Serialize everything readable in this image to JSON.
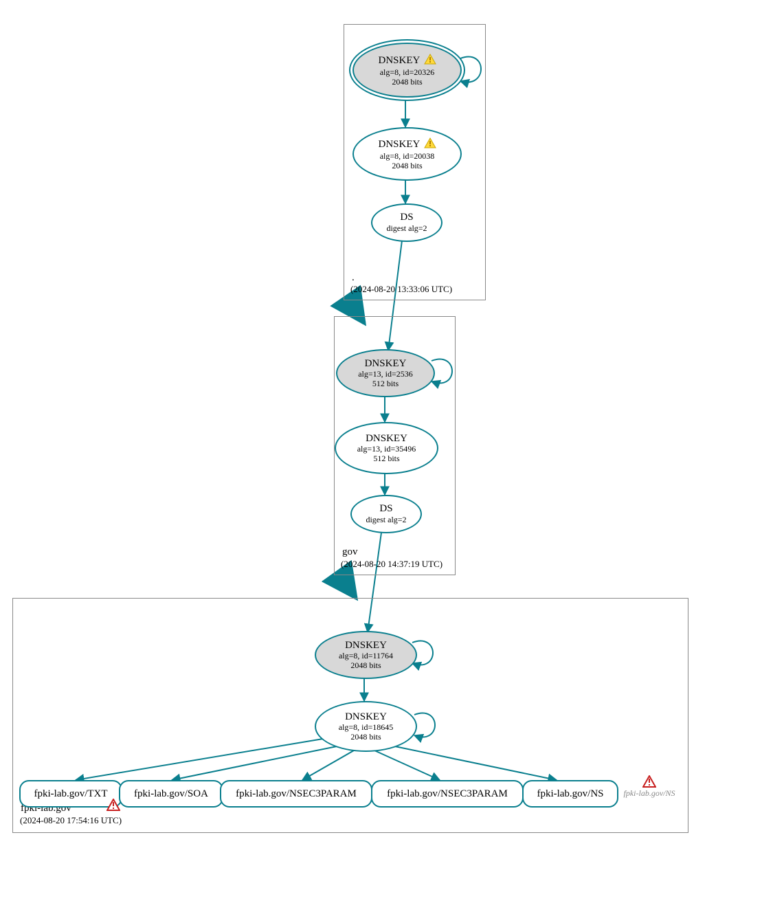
{
  "zones": {
    "root": {
      "label": ".",
      "timestamp": "(2024-08-20 13:33:06 UTC)",
      "nodes": {
        "ksk": {
          "title": "DNSKEY",
          "line2": "alg=8, id=20326",
          "line3": "2048 bits",
          "warn": true
        },
        "zsk": {
          "title": "DNSKEY",
          "line2": "alg=8, id=20038",
          "line3": "2048 bits",
          "warn": true
        },
        "ds": {
          "title": "DS",
          "line2": "digest alg=2"
        }
      }
    },
    "gov": {
      "label": "gov",
      "timestamp": "(2024-08-20 14:37:19 UTC)",
      "nodes": {
        "ksk": {
          "title": "DNSKEY",
          "line2": "alg=13, id=2536",
          "line3": "512 bits"
        },
        "zsk": {
          "title": "DNSKEY",
          "line2": "alg=13, id=35496",
          "line3": "512 bits"
        },
        "ds": {
          "title": "DS",
          "line2": "digest alg=2"
        }
      }
    },
    "fpki": {
      "label": "fpki-lab.gov",
      "timestamp": "(2024-08-20 17:54:16 UTC)",
      "nodes": {
        "ksk": {
          "title": "DNSKEY",
          "line2": "alg=8, id=11764",
          "line3": "2048 bits"
        },
        "zsk": {
          "title": "DNSKEY",
          "line2": "alg=8, id=18645",
          "line3": "2048 bits"
        }
      },
      "rr": {
        "txt": "fpki-lab.gov/TXT",
        "soa": "fpki-lab.gov/SOA",
        "nsec3a": "fpki-lab.gov/NSEC3PARAM",
        "nsec3b": "fpki-lab.gov/NSEC3PARAM",
        "ns": "fpki-lab.gov/NS",
        "ns_err": "fpki-lab.gov/NS"
      }
    }
  }
}
